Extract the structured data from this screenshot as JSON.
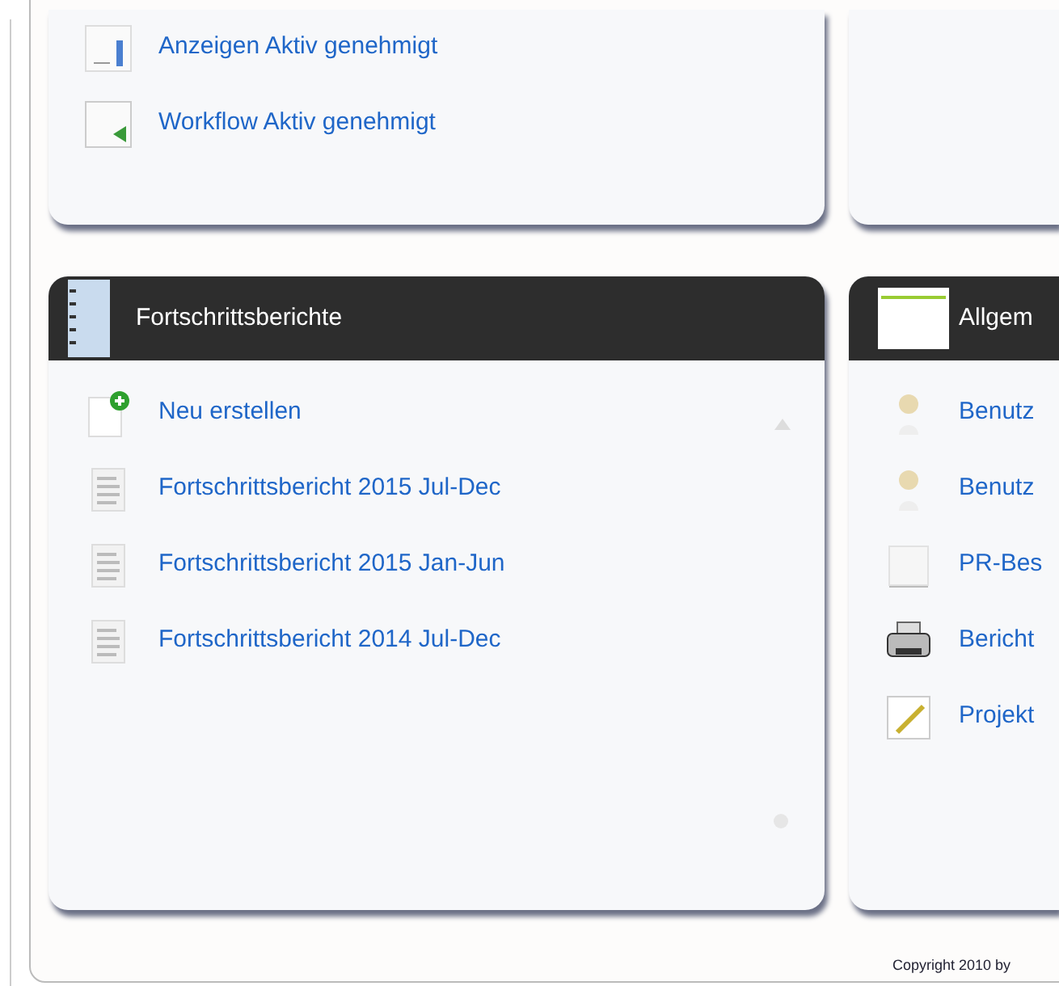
{
  "top_left_panel": {
    "items": [
      {
        "kind": "chart",
        "label": "Anzeigen Aktiv genehmigt"
      },
      {
        "kind": "workflow",
        "label": "Workflow Aktiv genehmigt"
      }
    ]
  },
  "progress_panel": {
    "title": "Fortschrittsberichte",
    "items": [
      {
        "kind": "new",
        "label": "Neu erstellen"
      },
      {
        "kind": "doc",
        "label": "Fortschrittsbericht 2015 Jul-Dec"
      },
      {
        "kind": "doc",
        "label": "Fortschrittsbericht 2015 Jan-Jun"
      },
      {
        "kind": "doc",
        "label": "Fortschrittsbericht 2014 Jul-Dec"
      }
    ]
  },
  "general_panel": {
    "title": "Allgem",
    "items": [
      {
        "kind": "user",
        "label": "Benutz"
      },
      {
        "kind": "user",
        "label": "Benutz"
      },
      {
        "kind": "blank",
        "label": "PR-Bes"
      },
      {
        "kind": "printer",
        "label": "Bericht"
      },
      {
        "kind": "edit",
        "label": "Projekt"
      }
    ]
  },
  "footer": {
    "copyright": "Copyright 2010 by"
  }
}
